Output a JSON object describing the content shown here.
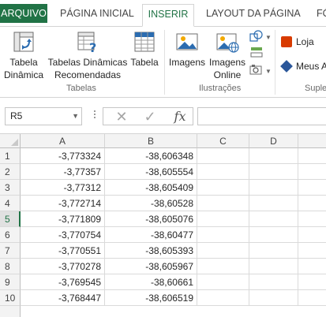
{
  "tabs": {
    "file": "ARQUIVO",
    "home": "PÁGINA INICIAL",
    "insert": "INSERIR",
    "layout": "LAYOUT DA PÁGINA",
    "formulas": "FÓ"
  },
  "ribbon": {
    "tables": {
      "pivot_line1": "Tabela",
      "pivot_line2": "Dinâmica",
      "recommended_line1": "Tabelas Dinâmicas",
      "recommended_line2": "Recomendadas",
      "table": "Tabela",
      "group_label": "Tabelas"
    },
    "illustrations": {
      "images": "Imagens",
      "online_line1": "Imagens",
      "online_line2": "Online",
      "group_label": "Ilustrações"
    },
    "addins": {
      "store": "Loja",
      "my_addins": "Meus A",
      "group_label": "Suple"
    }
  },
  "formula_bar": {
    "name_box": "R5",
    "cancel_glyph": "✕",
    "enter_glyph": "✓",
    "fx_glyph": "fx",
    "formula": ""
  },
  "grid": {
    "columns": [
      "A",
      "B",
      "C",
      "D"
    ],
    "selected_row": "5",
    "rows": [
      {
        "num": "1",
        "a": "-3,773324",
        "b": "-38,606348"
      },
      {
        "num": "2",
        "a": "-3,77357",
        "b": "-38,605554"
      },
      {
        "num": "3",
        "a": "-3,77312",
        "b": "-38,605409"
      },
      {
        "num": "4",
        "a": "-3,772714",
        "b": "-38,60528"
      },
      {
        "num": "5",
        "a": "-3,771809",
        "b": "-38,605076"
      },
      {
        "num": "6",
        "a": "-3,770754",
        "b": "-38,60477"
      },
      {
        "num": "7",
        "a": "-3,770551",
        "b": "-38,605393"
      },
      {
        "num": "8",
        "a": "-3,770278",
        "b": "-38,605967"
      },
      {
        "num": "9",
        "a": "-3,769545",
        "b": "-38,60661"
      },
      {
        "num": "10",
        "a": "-3,768447",
        "b": "-38,606519"
      }
    ]
  },
  "colors": {
    "accent": "#217346",
    "store_icon": "#d83b01",
    "my_addins_icon": "#2b579a"
  }
}
